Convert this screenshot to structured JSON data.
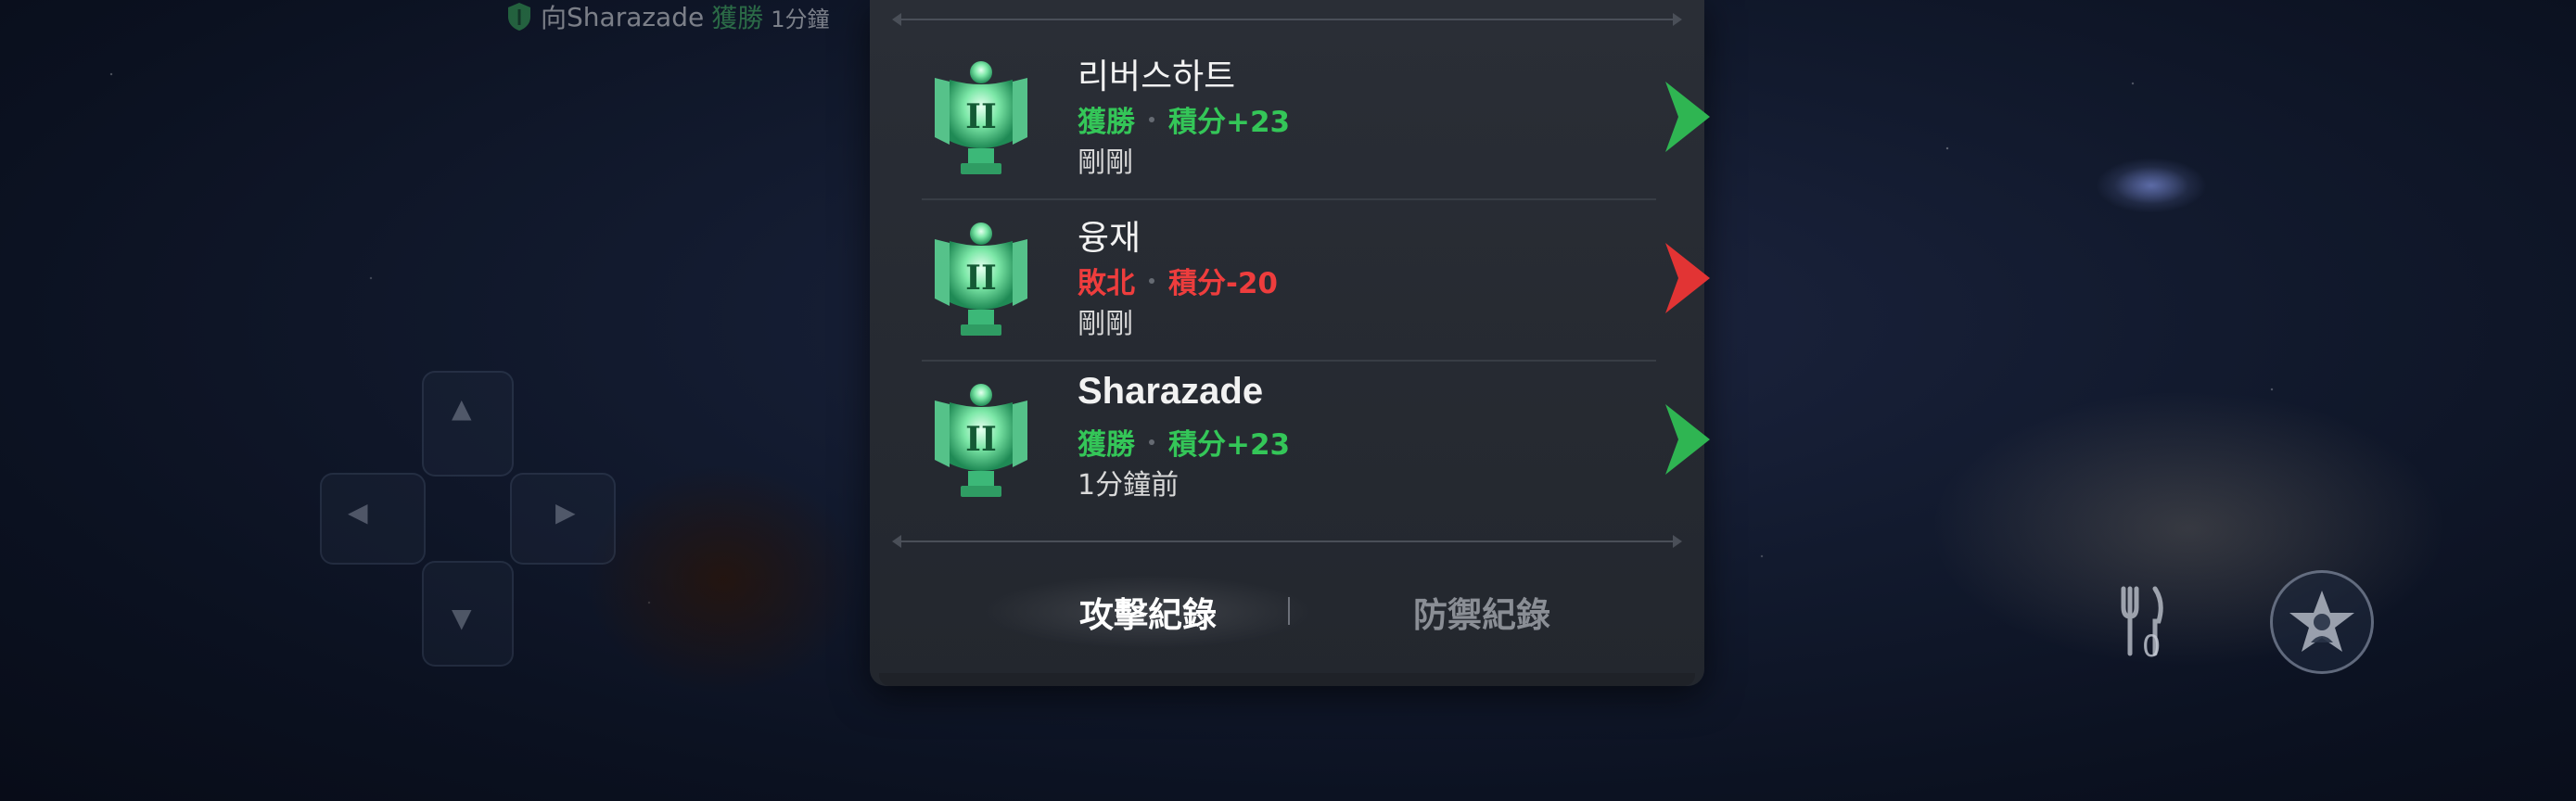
{
  "notification": {
    "prefix": "向",
    "opponent": "Sharazade",
    "result": "獲勝",
    "time": "1分鐘"
  },
  "records": [
    {
      "name": "리버스하트",
      "result": "獲勝",
      "points": "積分+23",
      "time": "剛剛",
      "outcome": "win",
      "tier": "II"
    },
    {
      "name": "융재",
      "result": "敗北",
      "points": "積分-20",
      "time": "剛剛",
      "outcome": "loss",
      "tier": "II"
    },
    {
      "name": "Sharazade",
      "result": "獲勝",
      "points": "積分+23",
      "time": "1分鐘前",
      "outcome": "win",
      "tier": "II"
    }
  ],
  "tabs": {
    "attack": "攻擊紀錄",
    "defense": "防禦紀錄"
  },
  "hud": {
    "count": "0"
  },
  "colors": {
    "win": "#34c658",
    "loss": "#ee3d3d",
    "emblem": "#6ce0a0"
  }
}
